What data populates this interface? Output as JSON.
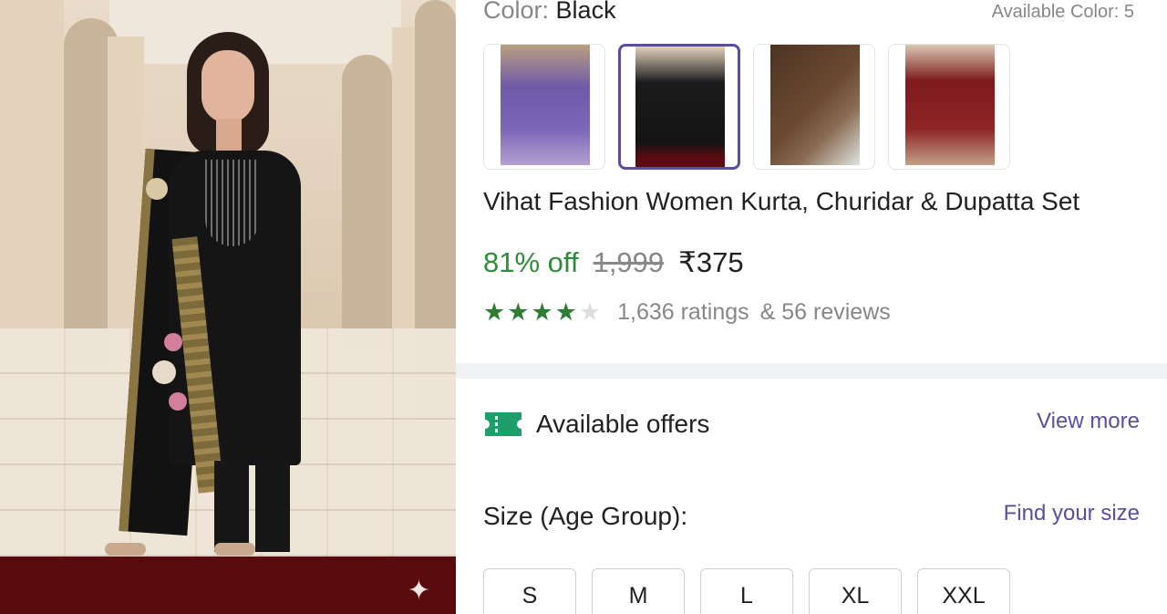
{
  "hero": {
    "image_alt": "Woman in black kurta with gold-bordered floral dupatta standing in an arched corridor",
    "sparkle_icon": "sparkle-icon"
  },
  "color": {
    "label": "Color:",
    "value": "Black",
    "available_text": "Available Color: 5"
  },
  "color_variants": [
    {
      "name": "Purple",
      "selected": false
    },
    {
      "name": "Black",
      "selected": true
    },
    {
      "name": "Brown",
      "selected": false
    },
    {
      "name": "Maroon",
      "selected": false
    }
  ],
  "product": {
    "title": "Vihat Fashion Women Kurta, Churidar & Dupatta Set",
    "discount": "81% off",
    "mrp": "1,999",
    "price": "₹375",
    "rating_stars": 4,
    "ratings_text": "1,636 ratings",
    "reviews_text": "& 56 reviews"
  },
  "offers": {
    "icon": "ticket-icon",
    "label": "Available offers",
    "view_more": "View more"
  },
  "size": {
    "label": "Size (Age Group):",
    "find_size": "Find your size",
    "options": [
      "S",
      "M",
      "L",
      "XL",
      "XXL"
    ]
  },
  "colors": {
    "accent": "#5b4e9a",
    "discount_green": "#2e8b3a",
    "star_green": "#2e7d32",
    "hero_band": "#5a0b0d"
  }
}
